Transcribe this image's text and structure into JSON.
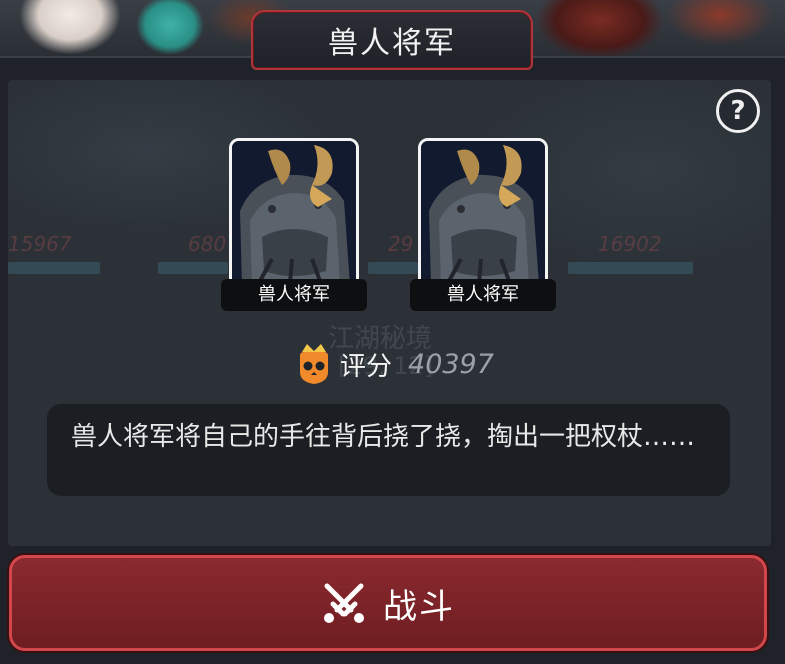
{
  "dialog": {
    "title": "兽人将军",
    "help_symbol": "?"
  },
  "enemies": [
    {
      "name": "兽人将军",
      "portrait": "orc-general-portrait"
    },
    {
      "name": "兽人将军",
      "portrait": "orc-general-portrait"
    }
  ],
  "score": {
    "label": "评分",
    "value": "40397",
    "icon": "skull-crown-icon"
  },
  "description": "兽人将军将自己的手往背后挠了挠，掏出一把权杖……",
  "fight_button": {
    "label": "战斗",
    "icon": "crossed-swords-icon"
  },
  "colors": {
    "accent_red": "#b2333a",
    "button_red": "#7a2328",
    "panel_bg": "#2b3137"
  }
}
